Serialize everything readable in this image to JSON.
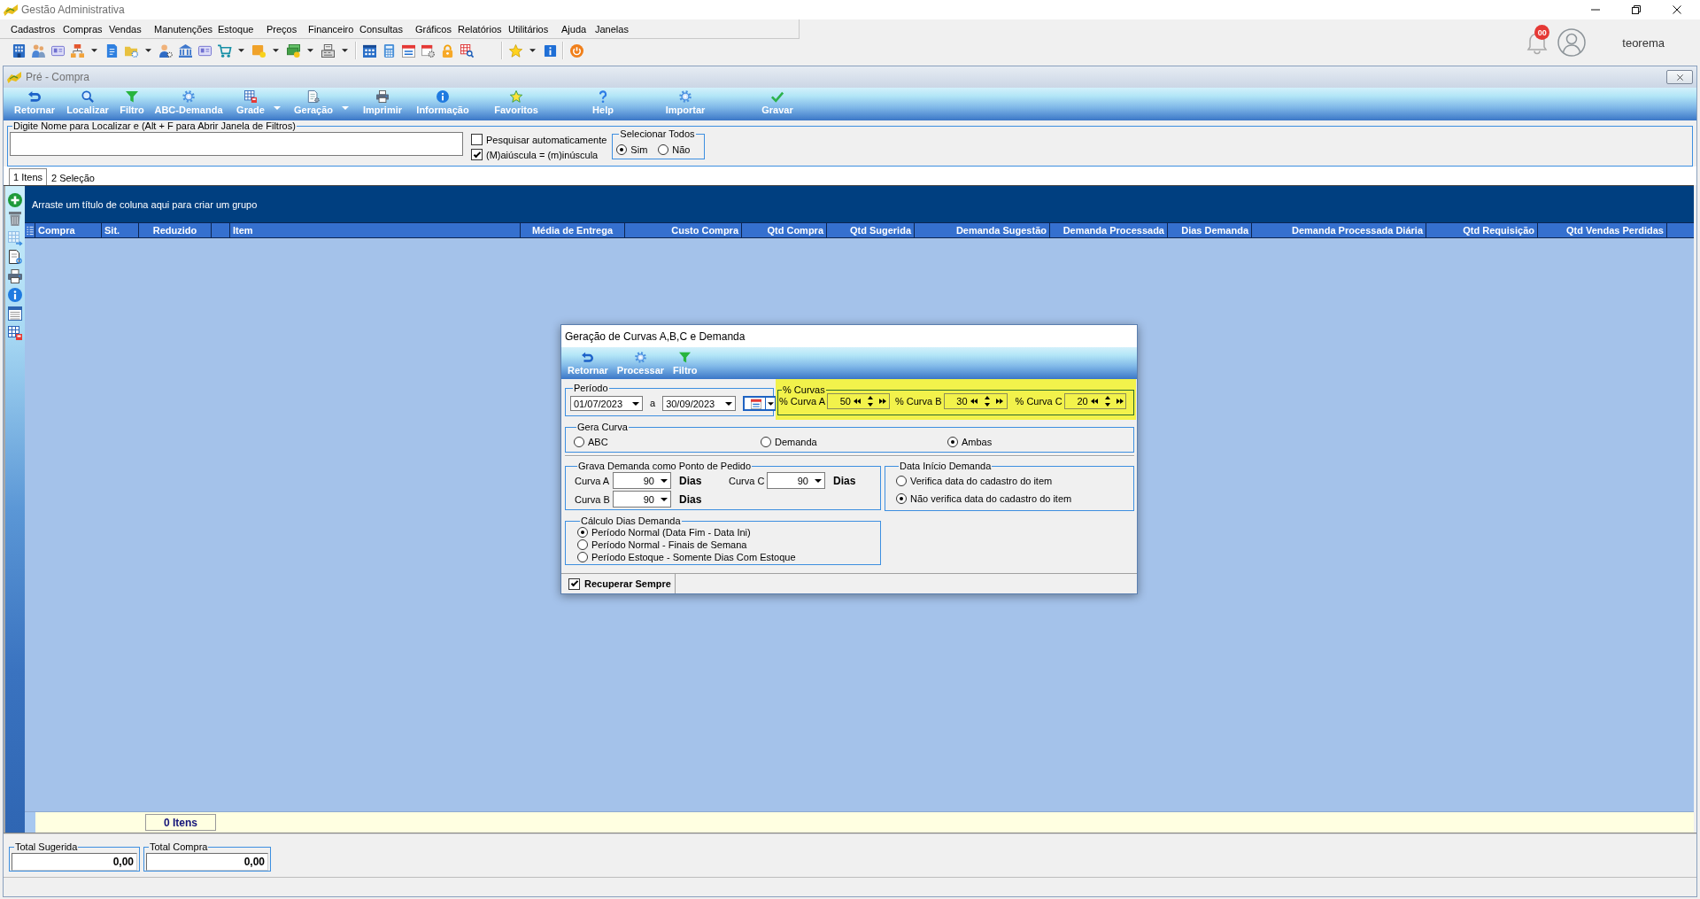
{
  "app_window": {
    "title": "Gestão Administrativa",
    "notification_badge": "00",
    "user_name": "teorema"
  },
  "menu": [
    "Cadastros",
    "Compras",
    "Vendas",
    "Manutenções",
    "Estoque",
    "Preços",
    "Financeiro",
    "Consultas",
    "Gráficos",
    "Relatórios",
    "Utilitários",
    "Ajuda",
    "Janelas"
  ],
  "child_window": {
    "title": "Pré - Compra",
    "toolbar": [
      {
        "label": "Retornar",
        "dropdown": false
      },
      {
        "label": "Localizar",
        "dropdown": false
      },
      {
        "label": "Filtro",
        "dropdown": false
      },
      {
        "label": "ABC-Demanda",
        "dropdown": false
      },
      {
        "label": "Grade",
        "dropdown": true
      },
      {
        "label": "Geração",
        "dropdown": true
      },
      {
        "label": "Imprimir",
        "dropdown": false
      },
      {
        "label": "Informação",
        "dropdown": false
      },
      {
        "label": "Favoritos",
        "dropdown": false
      },
      {
        "label": "Help",
        "dropdown": false
      },
      {
        "label": "Importar",
        "dropdown": false
      },
      {
        "label": "Gravar",
        "dropdown": false
      }
    ],
    "search": {
      "legend": "Digite Nome para Localizar e (Alt + F para Abrir Janela de Filtros)"
    },
    "search_options": [
      {
        "label": "Pesquisar automaticamente",
        "checked": false
      },
      {
        "label": "(M)aiúscula = (m)inúscula",
        "checked": true
      }
    ],
    "select_all": {
      "legend": "Selecionar Todos",
      "options": [
        {
          "label": "Sim",
          "selected": true
        },
        {
          "label": "Não",
          "selected": false
        }
      ]
    },
    "tabs": [
      {
        "label": "1 Itens",
        "selected": true
      },
      {
        "label": "2 Seleção",
        "selected": false
      }
    ],
    "grid": {
      "group_hint": "Arraste um título de coluna aqui para criar um grupo",
      "columns": [
        {
          "kind": "indicator"
        },
        {
          "kind": "text",
          "label": "Compra"
        },
        {
          "kind": "text",
          "label": "Sit."
        },
        {
          "kind": "text",
          "label": "Reduzido"
        },
        {
          "kind": "blank"
        },
        {
          "kind": "text",
          "label": "Item"
        },
        {
          "kind": "text",
          "label": "Média de Entrega"
        },
        {
          "kind": "text",
          "label": "Custo Compra"
        },
        {
          "kind": "text",
          "label": "Qtd Compra"
        },
        {
          "kind": "text",
          "label": "Qtd Sugerida"
        },
        {
          "kind": "text",
          "label": "Demanda Sugestão"
        },
        {
          "kind": "text",
          "label": "Demanda Processada"
        },
        {
          "kind": "text",
          "label": "Dias Demanda"
        },
        {
          "kind": "text",
          "label": "Demanda Processada Diária"
        },
        {
          "kind": "text",
          "label": "Qtd Requisição"
        },
        {
          "kind": "text",
          "label": "Qtd Vendas Perdidas"
        }
      ],
      "footer_count": "0 Itens"
    },
    "totals": [
      {
        "label": "Total Sugerida",
        "value": "0,00"
      },
      {
        "label": "Total Compra",
        "value": "0,00"
      }
    ]
  },
  "dialog": {
    "title": "Geração de Curvas A,B,C e Demanda",
    "toolbar": [
      "Retornar",
      "Processar",
      "Filtro"
    ],
    "period": {
      "legend": "Período",
      "from": "01/07/2023",
      "separator": "a",
      "to": "30/09/2023"
    },
    "curves": {
      "legend": "% Curvas",
      "fields": [
        {
          "label": "% Curva A",
          "value": "50"
        },
        {
          "label": "% Curva B",
          "value": "30"
        },
        {
          "label": "% Curva C",
          "value": "20"
        }
      ]
    },
    "curve_type": {
      "legend": "Gera Curva",
      "options": [
        {
          "label": "ABC",
          "selected": false
        },
        {
          "label": "Demanda",
          "selected": false
        },
        {
          "label": "Ambas",
          "selected": true
        }
      ]
    },
    "reorder_point": {
      "legend": "Grava Demanda como Ponto de Pedido",
      "fields": [
        {
          "label": "Curva A",
          "value": "90",
          "unit": "Dias"
        },
        {
          "label": "Curva C",
          "value": "90",
          "unit": "Dias"
        },
        {
          "label": "Curva B",
          "value": "90",
          "unit": "Dias"
        }
      ]
    },
    "start_date": {
      "legend": "Data Início Demanda",
      "options": [
        {
          "label": "Verifica data do cadastro do item",
          "selected": false
        },
        {
          "label": "Não verifica data do cadastro do item",
          "selected": true
        }
      ]
    },
    "days_calc": {
      "legend": "Cálculo Dias Demanda",
      "options": [
        {
          "label": "Período Normal (Data Fim - Data Ini)",
          "selected": true
        },
        {
          "label": "Período Normal - Finais de Semana",
          "selected": false
        },
        {
          "label": "Período Estoque - Somente Dias Com Estoque",
          "selected": false
        }
      ]
    },
    "recover_always": {
      "label": "Recuperar Sempre",
      "checked": true
    }
  }
}
